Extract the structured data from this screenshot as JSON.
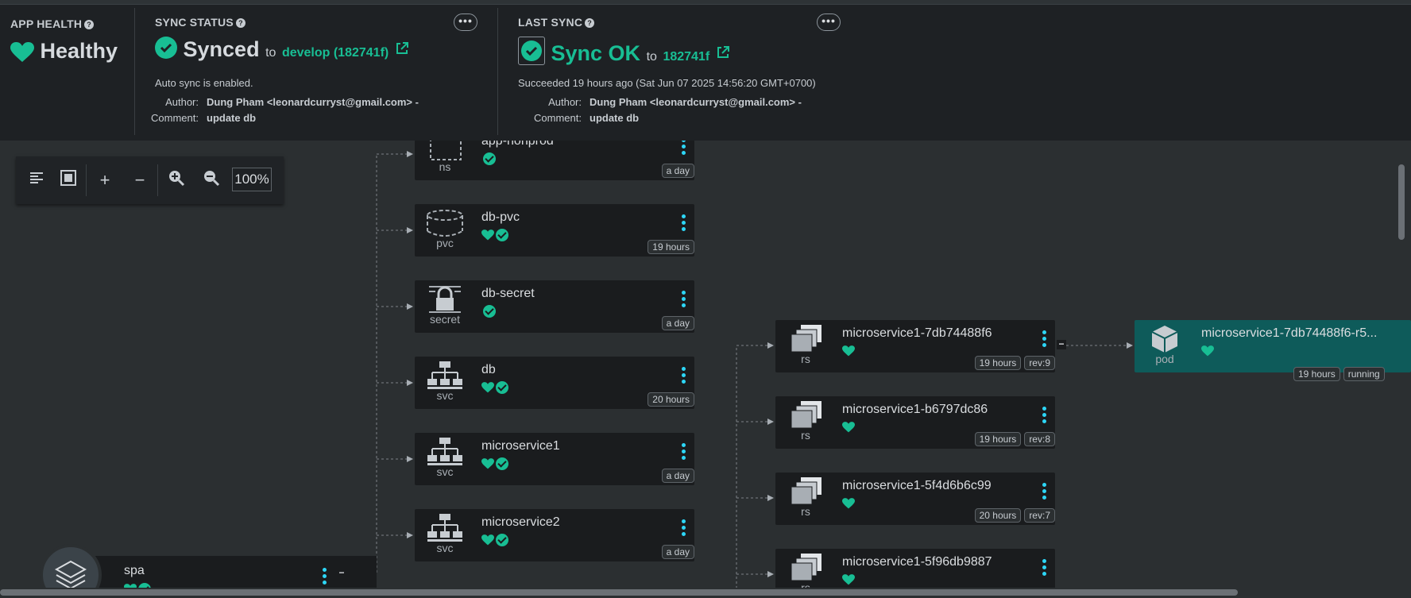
{
  "app_health": {
    "title": "APP HEALTH",
    "status": "Healthy"
  },
  "sync_status": {
    "title": "SYNC STATUS",
    "status": "Synced",
    "to_label": "to",
    "revision": "develop (182741f)",
    "auto_sync": "Auto sync is enabled.",
    "author_label": "Author:",
    "author": "Dung Pham <leonardcurryst@gmail.com> -",
    "comment_label": "Comment:",
    "comment": "update db",
    "more_label": "•••"
  },
  "last_sync": {
    "title": "LAST SYNC",
    "status": "Sync OK",
    "to_label": "to",
    "revision": "182741f",
    "succeeded": "Succeeded 19 hours ago (Sat Jun 07 2025 14:56:20 GMT+0700)",
    "author_label": "Author:",
    "author": "Dung Pham <leonardcurryst@gmail.com> -",
    "comment_label": "Comment:",
    "comment": "update db",
    "more_label": "•••"
  },
  "toolbar": {
    "zoom": "100%"
  },
  "root_node": {
    "name": "spa"
  },
  "resources": [
    {
      "name": "app-nonprod",
      "kind": "ns",
      "age": "a day",
      "icon": "namespace-icon",
      "health": false,
      "synced": true
    },
    {
      "name": "db-pvc",
      "kind": "pvc",
      "age": "19 hours",
      "icon": "volume-icon",
      "health": true,
      "synced": true
    },
    {
      "name": "db-secret",
      "kind": "secret",
      "age": "a day",
      "icon": "secret-icon",
      "health": false,
      "synced": true
    },
    {
      "name": "db",
      "kind": "svc",
      "age": "20 hours",
      "icon": "service-icon",
      "health": true,
      "synced": true
    },
    {
      "name": "microservice1",
      "kind": "svc",
      "age": "a day",
      "icon": "service-icon",
      "health": true,
      "synced": true
    },
    {
      "name": "microservice2",
      "kind": "svc",
      "age": "a day",
      "icon": "service-icon",
      "health": true,
      "synced": true
    }
  ],
  "replicasets": [
    {
      "name": "microservice1-7db74488f6",
      "kind": "rs",
      "age": "19 hours",
      "rev": "rev:9"
    },
    {
      "name": "microservice1-b6797dc86",
      "kind": "rs",
      "age": "19 hours",
      "rev": "rev:8"
    },
    {
      "name": "microservice1-5f4d6b6c99",
      "kind": "rs",
      "age": "20 hours",
      "rev": "rev:7"
    },
    {
      "name": "microservice1-5f96db9887",
      "kind": "rs",
      "age": "",
      "rev": ""
    }
  ],
  "pod": {
    "name": "microservice1-7db74488f6-r5...",
    "kind": "pod",
    "age": "19 hours",
    "state": "running"
  },
  "colors": {
    "accent": "#18be94",
    "menu_dots": "#2dd6f6",
    "pod_bg": "#0e5b5a"
  }
}
